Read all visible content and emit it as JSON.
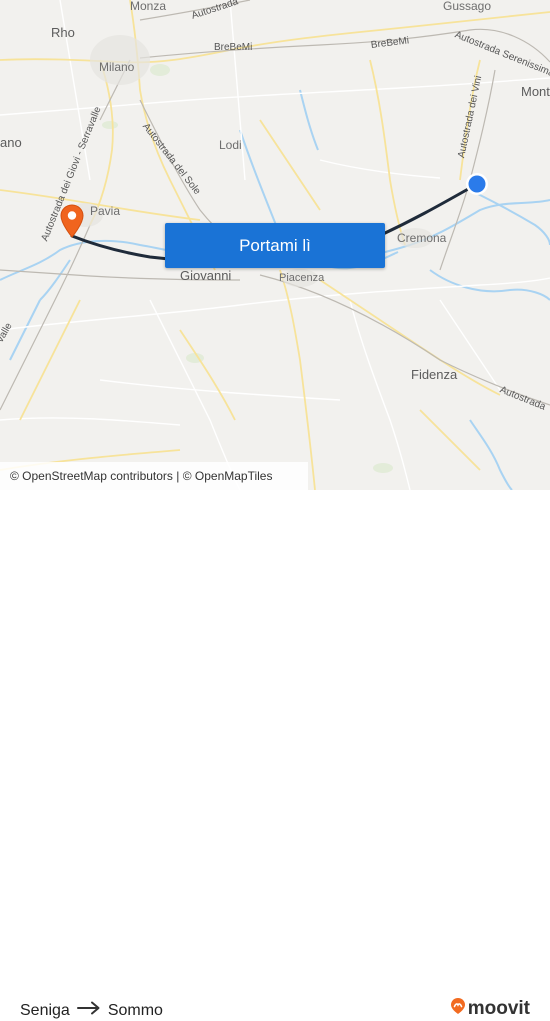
{
  "map": {
    "places": [
      {
        "id": "monza",
        "label": "Monza"
      },
      {
        "id": "gussago",
        "label": "Gussago"
      },
      {
        "id": "rho",
        "label": "Rho"
      },
      {
        "id": "milano",
        "label": "Milano"
      },
      {
        "id": "lodi",
        "label": "Lodi"
      },
      {
        "id": "pavia",
        "label": "Pavia"
      },
      {
        "id": "cremona",
        "label": "Cremona"
      },
      {
        "id": "giovanni",
        "label": "Giovanni"
      },
      {
        "id": "piacenza",
        "label": "Piacenza"
      },
      {
        "id": "fidenza",
        "label": "Fidenza"
      },
      {
        "id": "mont",
        "label": "Mont"
      },
      {
        "id": "ano",
        "label": "ano"
      }
    ],
    "road_labels": [
      {
        "id": "autostrada-top",
        "label": "Autostrada"
      },
      {
        "id": "brebemi-1",
        "label": "BreBeMi"
      },
      {
        "id": "brebemi-2",
        "label": "BreBeMi"
      },
      {
        "id": "serenissima",
        "label": "Autostrada Serenissima"
      },
      {
        "id": "vini",
        "label": "Autostrada dei Vini"
      },
      {
        "id": "sole",
        "label": "Autostrada del Sole"
      },
      {
        "id": "giovi",
        "label": "Autostrada dei Giovi - Serravalle"
      },
      {
        "id": "valle",
        "label": "valle"
      },
      {
        "id": "autostrada-br",
        "label": "Autostrada"
      }
    ],
    "colors": {
      "route": "#1f2b3a",
      "origin_marker": "#2b7bea",
      "destination_marker": "#f0641e",
      "button": "#1a73d6",
      "water": "#a9d3f2",
      "roads": "#f7e39a",
      "brand": "#f26b21"
    }
  },
  "cta": {
    "label": "Portami lì"
  },
  "attribution": {
    "text": "© OpenStreetMap contributors | © OpenMapTiles"
  },
  "route": {
    "origin": "Seniga",
    "arrow_icon": "arrow-right-icon",
    "destination": "Sommo"
  },
  "brand": {
    "name": "moovit",
    "icon": "moovit-pin-icon"
  }
}
